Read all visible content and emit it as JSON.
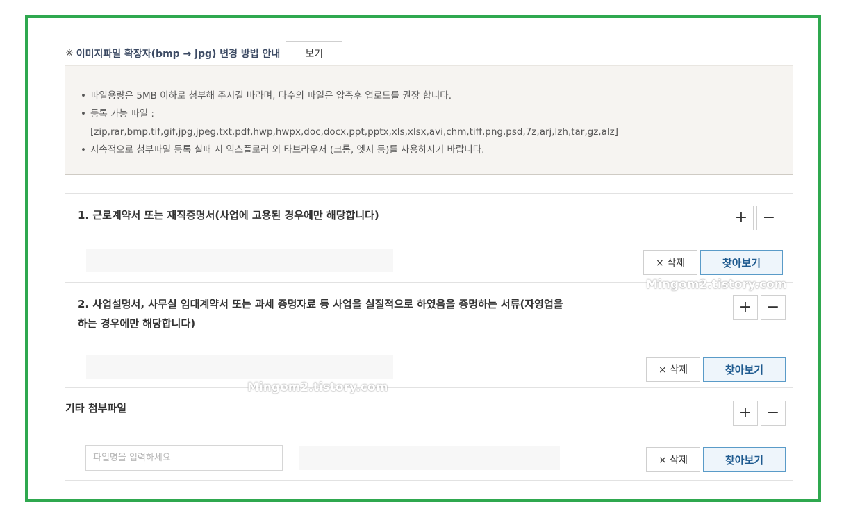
{
  "guide": {
    "mark": "※",
    "text": "이미지파일 확장자(bmp → jpg) 변경 방법 안내",
    "view_label": "보기"
  },
  "notice": {
    "lines": [
      "파일용량은 5MB 이하로 첨부해 주시길 바라며, 다수의 파일은 압축후 업로드를 권장 합니다.",
      "등록 가능 파일 :",
      "[zip,rar,bmp,tif,gif,jpg,jpeg,txt,pdf,hwp,hwpx,doc,docx,ppt,pptx,xls,xlsx,avi,chm,tiff,png,psd,7z,arj,lzh,tar,gz,alz]",
      "지속적으로 첨부파일 등록 실패 시 익스플로러 외 타브라우저 (크롬, 엣지 등)를 사용하시기 바랍니다."
    ],
    "bullet": "•"
  },
  "sections": [
    {
      "title": "1. 근로계약서 또는 재직증명서(사업에 고용된 경우에만 해당합니다)",
      "plus": "+",
      "minus": "−",
      "delete_label": "× 삭제",
      "find_label": "찾아보기"
    },
    {
      "title_line1": "2. 사업설명서, 사무실 임대계약서 또는 과세 증명자료 등 사업을 실질적으로 하였음을 증명하는 서류(자영업을",
      "title_line2": "하는 경우에만 해당합니다)",
      "plus": "+",
      "minus": "−",
      "delete_label": "× 삭제",
      "find_label": "찾아보기"
    },
    {
      "title": "기타 첨부파일",
      "plus": "+",
      "minus": "−",
      "input_placeholder": "파일명을 입력하세요",
      "delete_label": "× 삭제",
      "find_label": "찾아보기"
    }
  ],
  "watermark": "Mingom2.tistory.com",
  "colors": {
    "frame": "#2fa84f",
    "find_button_border": "#5a9bc8",
    "find_button_text": "#1e5a8f"
  }
}
